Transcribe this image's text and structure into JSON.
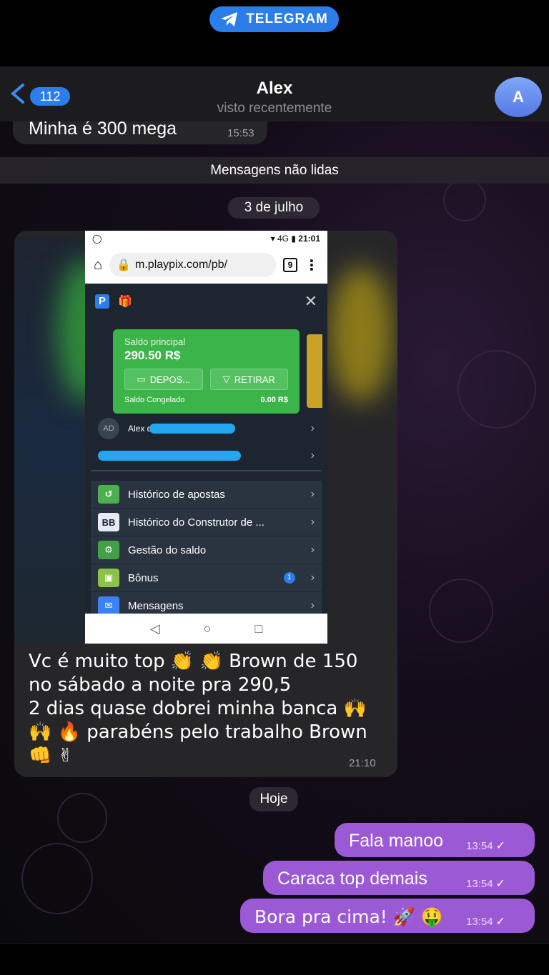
{
  "app": {
    "badge_label": "TELEGRAM"
  },
  "header": {
    "unread_count": "112",
    "name": "Alex",
    "status": "visto recentemente",
    "avatar_letter": "A"
  },
  "messages": {
    "prev": {
      "text": "Minha é 300 mega",
      "time": "15:53"
    },
    "unread_label": "Mensagens não lidas",
    "date1": "3 de julho",
    "photo_caption_lines": [
      "Vc é muito top 👏 👏 Brown de 150",
      "no sábado a noite pra 290,5",
      "2 dias quase dobrei minha banca 🙌",
      "🙌 🔥  parabéns pelo trabalho Brown",
      "👊 ✌"
    ],
    "photo_time": "21:10",
    "date2": "Hoje",
    "outgoing": [
      {
        "text": "Fala manoo",
        "time": "13:54"
      },
      {
        "text": "Caraca top demais",
        "time": "13:54"
      },
      {
        "text": "Bora pra cima! 🚀 🤑",
        "time": "13:54"
      }
    ]
  },
  "screenshot": {
    "clock": "21:01",
    "net": "4G",
    "url": "m.playpix.com/pb/",
    "tabs": "9",
    "balance_label": "Saldo principal",
    "balance_value": "290.50 R$",
    "deposit_label": "DEPOS...",
    "withdraw_label": "RETIRAR",
    "frozen_label": "Saldo Congelado",
    "frozen_value": "0.00 R$",
    "user_initials": "AD",
    "user_name": "Alex d",
    "menu": [
      {
        "label": "Histórico de apostas",
        "icon": "history-icon",
        "color": "#4caf50",
        "glyph": "↺"
      },
      {
        "label": "Histórico do Construtor de ...",
        "icon": "bet-builder-icon",
        "color": "#e8eaf6",
        "glyph": "BB"
      },
      {
        "label": "Gestão do saldo",
        "icon": "wallet-gear-icon",
        "color": "#43a047",
        "glyph": "⚙"
      },
      {
        "label": "Bônus",
        "icon": "bonus-icon",
        "color": "#8bc34a",
        "glyph": "▣",
        "badge": "1"
      },
      {
        "label": "Mensagens",
        "icon": "mail-icon",
        "color": "#3b82f6",
        "glyph": "✉"
      }
    ]
  }
}
